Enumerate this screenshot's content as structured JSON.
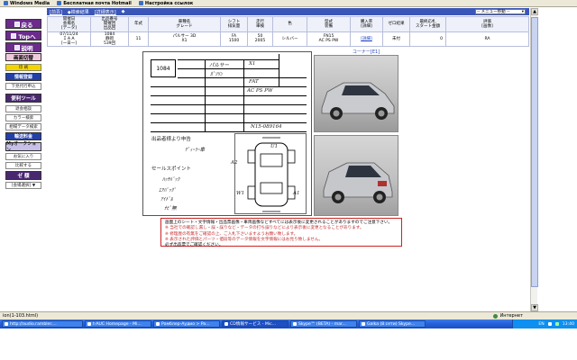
{
  "browser_links": [
    "Windows Media",
    "Бесплатная почта Hotmail",
    "Настройка ссылок"
  ],
  "sidebar": {
    "items": [
      {
        "label": "戻る",
        "style": "purple"
      },
      {
        "label": "Topへ",
        "style": "purple"
      },
      {
        "label": "説明",
        "style": "purple"
      },
      {
        "label": "画面切替",
        "style": "pink"
      },
      {
        "label": "印 刷",
        "style": "small"
      },
      {
        "label": "情報登録",
        "style": "blue"
      },
      {
        "label": "下見代行申込",
        "style": "small"
      },
      {
        "label": "便利ツール",
        "style": "navy"
      },
      {
        "label": "退会相談",
        "style": "small"
      },
      {
        "label": "カラー検索",
        "style": "small"
      },
      {
        "label": "相場データ検索",
        "style": "small"
      },
      {
        "label": "輸送料金",
        "style": "blue"
      },
      {
        "label": "Myオークション",
        "style": "lav"
      },
      {
        "label": "お気に入り",
        "style": "small"
      },
      {
        "label": "比較する",
        "style": "small"
      },
      {
        "label": "ゼ 額",
        "style": "navy"
      },
      {
        "label": "[会場選択] ▼",
        "style": "small"
      }
    ]
  },
  "header_bar": {
    "left_items": [
      "[前頁]",
      "◆検索結果",
      "[詳細表示]",
      "◆"
    ],
    "menu_select": "-- メニュー移動 --"
  },
  "table": {
    "headers": [
      "開催日\n会場名\n[データ]",
      "出品番号\n開催回\n出品回",
      "年式",
      "車種名\nグレード",
      "シフト\n排気量",
      "走行\n車検",
      "色",
      "型式\n装備",
      "購入率\n[詳細]",
      "ゼロ結果",
      "最終応札\nスタート金額",
      "評価\n[画像]"
    ],
    "row": [
      "07/11/24\nＩＡＡ\n[一日一]",
      "1084\n静岡\n539回",
      "11",
      "パルサー 3D\nX1",
      "FA\n1500",
      "50\n2005",
      "シルバー",
      "FN15\nAC PS PW",
      "[詳細]",
      "未付",
      "0",
      "RA"
    ]
  },
  "sheet": {
    "lot": "1084",
    "handwriting": [
      "パルサー",
      "X1",
      "ｶﾞｿﾘﾝ",
      "FAT",
      "AC PS PW",
      "N15-089164",
      "ﾃﾞｨｰﾗｰ車",
      "ﾊｯﾁﾊﾞｯｸ",
      "ｴｱﾊﾞｯｸﾞ",
      "ｱｲﾄﾞﾙ",
      "ﾅﾋﾞ無",
      "A2",
      "U1",
      "A1",
      "W1"
    ],
    "labels": [
      "出品者様より申告",
      "セールスポイント",
      "検査員報告",
      "付属品",
      "コーナー[E1]"
    ]
  },
  "photos": [
    {
      "alt": "silver Nissan Pulsar hatchback front three-quarter view"
    },
    {
      "alt": "silver Nissan Pulsar hatchback rear three-quarter view"
    }
  ],
  "notice": [
    {
      "text": "画面上のシート・文字情報・出品票画像・車両画像などすべてには表示後に変更されることがありますのでご注意下さい。",
      "color": "#000000"
    },
    {
      "text": "※ 当社での確認し漏し・誤・誤りなど・データの打ち誤りなどにより表示後に変更となることがあります。",
      "color": "#c2292b"
    },
    {
      "text": "※ 修理歴の有無をご確認の上、ご入札下さいますようお願い致します。",
      "color": "#c2292b"
    },
    {
      "text": "※ 表示された評価とパーツ・値段等のデータ情報を文字情報にはお見り致しません。",
      "color": "#c2292b"
    },
    {
      "text": "必ず出品票でご確認ください。",
      "color": "#000000"
    }
  ],
  "status": {
    "left": "ion(1-103.html)",
    "zone": "Интернет"
  },
  "taskbar": {
    "items": [
      "http://audio.rambler....",
      "t-AUC Homepage - Mi...",
      "Рамблер-Аудио > Pa...",
      "CD情報サービス - Mic...",
      "Skype™ (BETA) - mar...",
      "Galka (8 сети) Skype..."
    ],
    "lang": "EN",
    "time": "13:40"
  }
}
